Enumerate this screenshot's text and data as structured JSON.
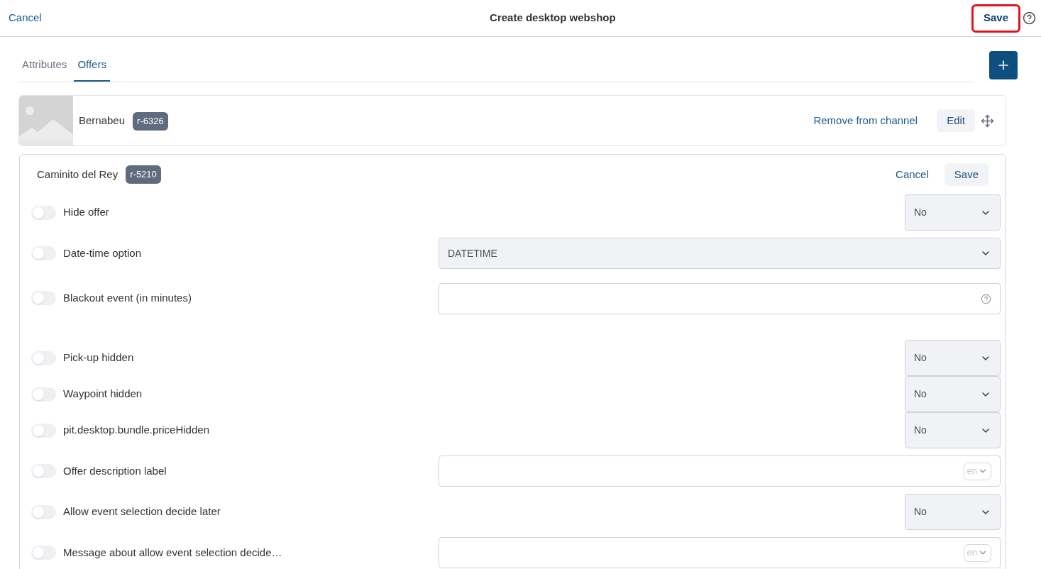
{
  "header": {
    "cancel": "Cancel",
    "title": "Create desktop webshop",
    "save": {
      "label": "Save",
      "highlighted": true
    }
  },
  "tabs": [
    {
      "label": "Attributes",
      "selected": false
    },
    {
      "label": "Offers",
      "selected": true
    }
  ],
  "offers": [
    {
      "name": "Bernabeu",
      "badge": "r-6326",
      "remove": "Remove from channel",
      "edit": "Edit"
    }
  ],
  "editor": {
    "name": "Caminito del Rey",
    "badge": "r-5210",
    "cancel": "Cancel",
    "save": "Save",
    "rows": [
      {
        "label": "Hide offer",
        "on": false,
        "kind": "select",
        "value": "No"
      },
      {
        "label": "Date-time option",
        "on": false,
        "kind": "select_wide",
        "value": "DATETIME"
      },
      {
        "label": "Blackout event (in minutes)",
        "on": false,
        "kind": "text_help"
      },
      {
        "label": "Pick-up hidden",
        "on": false,
        "kind": "select",
        "value": "No"
      },
      {
        "label": "Waypoint hidden",
        "on": false,
        "kind": "select",
        "value": "No"
      },
      {
        "label": "pit.desktop.bundle.priceHidden",
        "on": false,
        "kind": "select",
        "value": "No"
      },
      {
        "label": "Offer description label",
        "on": false,
        "kind": "text_lang",
        "lang": "en"
      },
      {
        "label": "Allow event selection decide later",
        "on": false,
        "kind": "select",
        "value": "No"
      },
      {
        "label": "Message about allow event selection decide…",
        "on": false,
        "kind": "text_lang",
        "lang": "en"
      }
    ]
  }
}
